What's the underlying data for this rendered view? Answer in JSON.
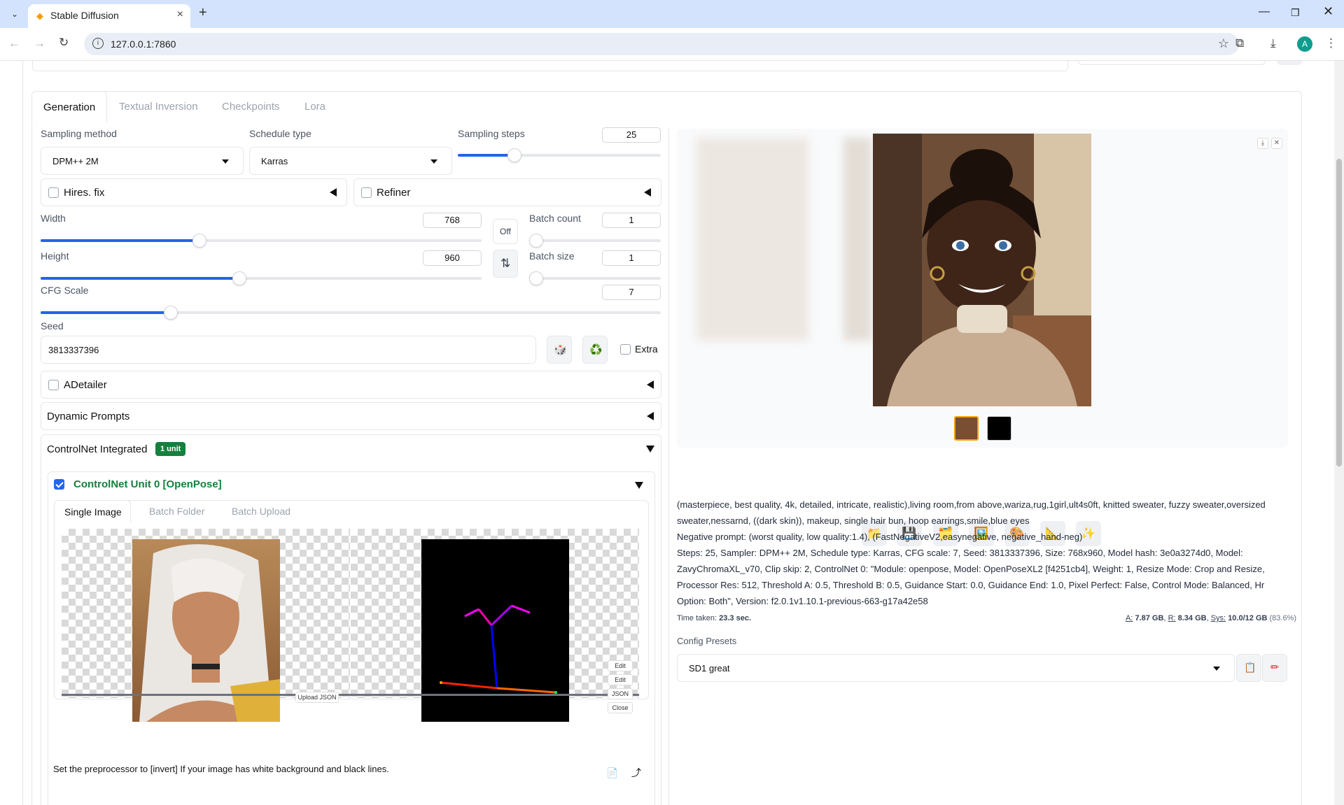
{
  "browser": {
    "tab_title": "Stable Diffusion",
    "url": "127.0.0.1:7860",
    "new_tab": "+",
    "profile_initial": "A"
  },
  "tabs": [
    "Generation",
    "Textual Inversion",
    "Checkpoints",
    "Lora"
  ],
  "sampling": {
    "method_label": "Sampling method",
    "method_value": "DPM++ 2M",
    "schedule_label": "Schedule type",
    "schedule_value": "Karras",
    "steps_label": "Sampling steps",
    "steps_value": "25",
    "steps_fraction": 0.28
  },
  "hires_fix": {
    "label": "Hires. fix",
    "checked": false
  },
  "refiner": {
    "label": "Refiner",
    "checked": false
  },
  "width": {
    "label": "Width",
    "value": "768",
    "fraction": 0.36
  },
  "height": {
    "label": "Height",
    "value": "960",
    "fraction": 0.45
  },
  "off_button": "Off",
  "swap_icon": "⇅",
  "batch_count": {
    "label": "Batch count",
    "value": "1"
  },
  "batch_size": {
    "label": "Batch size",
    "value": "1"
  },
  "cfg": {
    "label": "CFG Scale",
    "value": "7",
    "fraction": 0.21
  },
  "seed": {
    "label": "Seed",
    "value": "3813337396",
    "extra_label": "Extra",
    "dice_icon": "🎲",
    "recycle_icon": "♻️"
  },
  "adetailer": {
    "label": "ADetailer"
  },
  "dynamic_prompts": {
    "label": "Dynamic Prompts"
  },
  "controlnet": {
    "label": "ControlNet Integrated",
    "badge": "1 unit",
    "unit_label": "ControlNet Unit 0 [OpenPose]",
    "subtabs": [
      "Single Image",
      "Batch Folder",
      "Batch Upload"
    ],
    "upload_json": "Upload JSON",
    "edit_buttons": [
      "Edit",
      "Edit",
      "JSON",
      "Close"
    ],
    "hint": "Set the preprocessor to [invert] If your image has white background and black lines."
  },
  "output": {
    "prompt": "(masterpiece, best quality, 4k, detailed, intricate, realistic),living room,from above,wariza,rug,1girl,ult4s0ft, knitted sweater, fuzzy sweater,oversized sweater,nessarnd, ((dark skin)), makeup, single hair bun, hoop earrings,smile,blue eyes",
    "negative": "Negative prompt: (worst quality, low quality:1.4), (FastNegativeV2,easynegative, negative_hand-neg)",
    "params": "Steps: 25, Sampler: DPM++ 2M, Schedule type: Karras, CFG scale: 7, Seed: 3813337396, Size: 768x960, Model hash: 3e0a3274d0, Model: ZavyChromaXL_v70, Clip skip: 2, ControlNet 0: \"Module: openpose, Model: OpenPoseXL2 [f4251cb4], Weight: 1, Resize Mode: Crop and Resize, Processor Res: 512, Threshold A: 0.5, Threshold B: 0.5, Guidance Start: 0.0, Guidance End: 1.0, Pixel Perfect: False, Control Mode: Balanced, Hr Option: Both\", Version: f2.0.1v1.10.1-previous-663-g17a42e58",
    "time_label": "Time taken:",
    "time_value": "23.3 sec.",
    "mem_a_label": "A:",
    "mem_a": "7.87 GB",
    "mem_r_label": "R:",
    "mem_r": "8.34 GB",
    "mem_sys_label": "Sys:",
    "mem_sys": "10.0/12 GB",
    "mem_pct": "(83.6%)"
  },
  "tool_icons": [
    "📁",
    "💾",
    "🗂️",
    "🖼️",
    "🎨",
    "📐",
    "✨"
  ],
  "config_presets": {
    "label": "Config Presets",
    "value": "SD1 great"
  },
  "colors": {
    "accent": "#2563eb",
    "controlnet_green": "#15803d"
  }
}
